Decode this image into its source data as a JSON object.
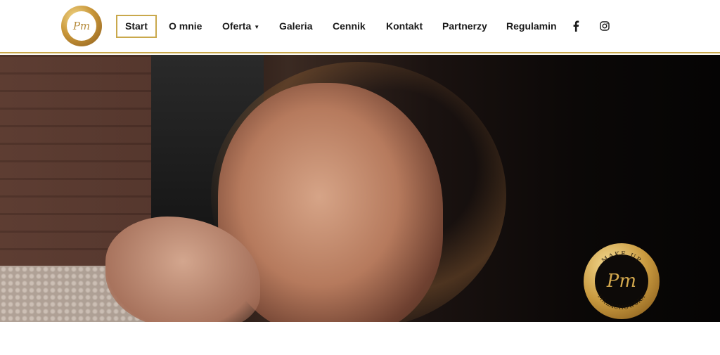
{
  "nav": {
    "items": [
      {
        "label": "Start",
        "active": true
      },
      {
        "label": "O mnie"
      },
      {
        "label": "Oferta",
        "has_dropdown": true
      },
      {
        "label": "Galeria"
      },
      {
        "label": "Cennik"
      },
      {
        "label": "Kontakt"
      },
      {
        "label": "Partnerzy"
      },
      {
        "label": "Regulamin"
      }
    ]
  },
  "logo": {
    "monogram": "Pm",
    "ring_top": "MAKE UP",
    "ring_bottom": "MALACHOWSKA"
  },
  "social": [
    {
      "icon": "facebook-icon"
    },
    {
      "icon": "instagram-icon"
    }
  ],
  "colors": {
    "accent_gold": "#c9a84c",
    "text": "#1a1a1a"
  }
}
